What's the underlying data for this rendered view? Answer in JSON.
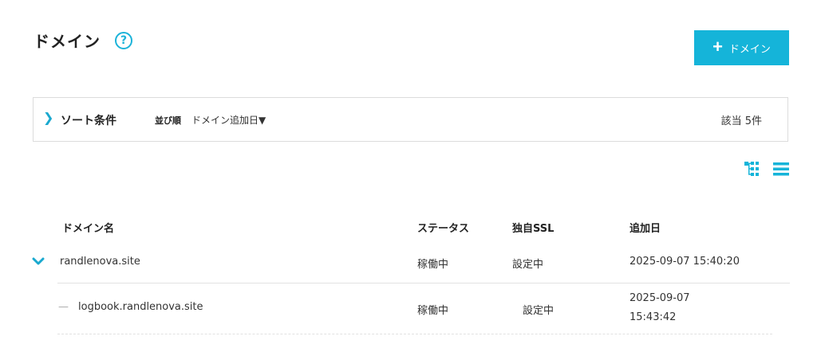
{
  "header": {
    "title": "ドメイン",
    "help_icon": "?",
    "add_button_label": "ドメイン"
  },
  "sort": {
    "title": "ソート条件",
    "order_label": "並び順",
    "order_value": "ドメイン追加日▼",
    "count_text": "該当 5件"
  },
  "view_icons": [
    "tree-view-icon",
    "list-view-icon"
  ],
  "table": {
    "columns": [
      "ドメイン名",
      "ステータス",
      "独自SSL",
      "追加日"
    ],
    "rows": [
      {
        "domain": "randlenova.site",
        "status": "稼働中",
        "ssl": "設定中",
        "added": "2025-09-07 15:40:20"
      },
      {
        "domain": "logbook.randlenova.site",
        "status": "稼働中",
        "ssl": "設定中",
        "added_date": "2025-09-07",
        "added_time": "15:43:42"
      }
    ]
  },
  "colors": {
    "accent": "#15b4d9",
    "border": "#dcdcdc",
    "text": "#333333"
  }
}
